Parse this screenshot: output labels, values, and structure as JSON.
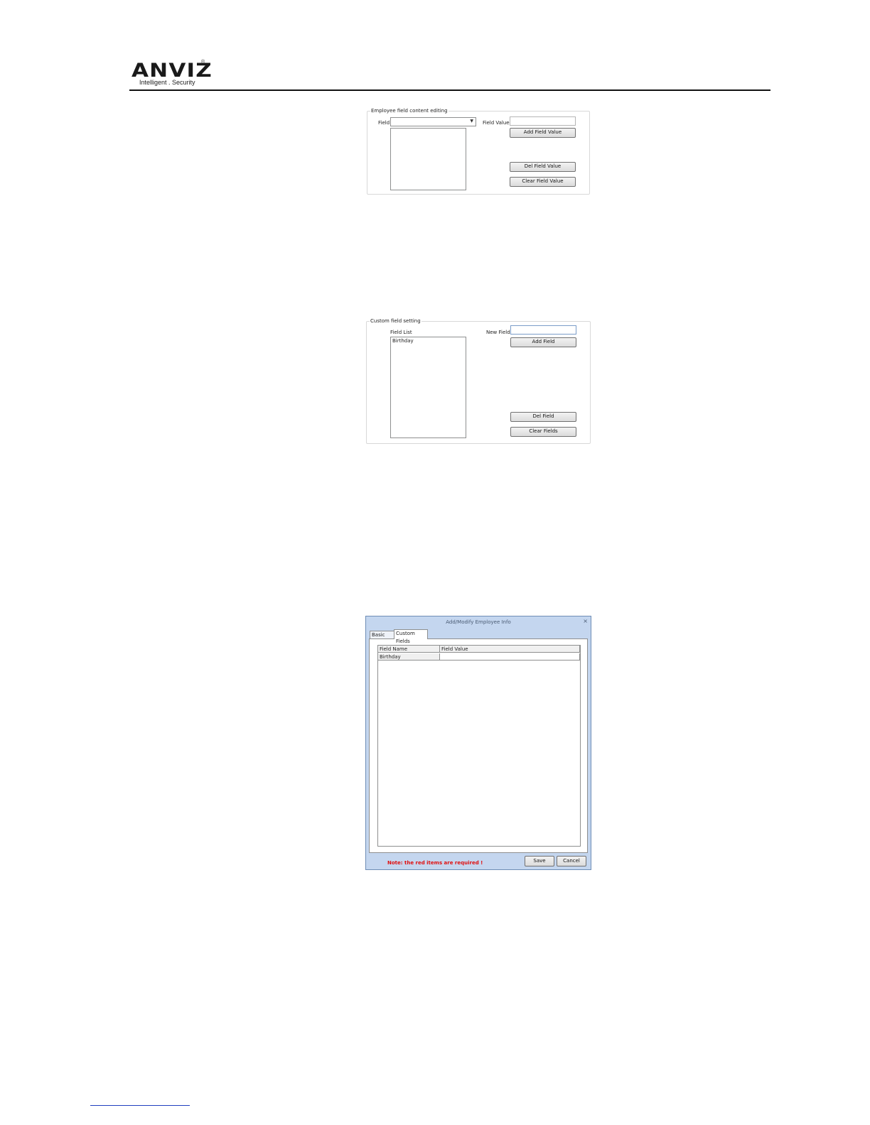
{
  "header": {
    "logo_text": "ANVIZ",
    "registered_mark": "®",
    "tagline": "Intelligent . Security"
  },
  "field_editing_panel": {
    "title": "Employee field content editing",
    "field_label": "Field",
    "field_selected": "",
    "field_value_label": "Field Value",
    "field_value_input": "",
    "values": [],
    "add_button": "Add Field Value",
    "del_button": "Del Field Value",
    "clear_button": "Clear Field Value"
  },
  "custom_field_panel": {
    "title": "Custom field setting",
    "field_list_label": "Field List",
    "new_field_label": "New Field",
    "new_field_input": "",
    "fields": [
      "Birthday"
    ],
    "add_button": "Add Field",
    "del_button": "Del Field",
    "clear_button": "Clear Fields"
  },
  "dialog": {
    "title": "Add/Modify Employee Info",
    "close_glyph": "×",
    "tabs": [
      {
        "label": "Basic Info",
        "active": false
      },
      {
        "label": "Custom Fields",
        "active": true
      }
    ],
    "grid": {
      "columns": [
        "Field Name",
        "Field Value"
      ],
      "rows": [
        {
          "name": "Birthday",
          "value": ""
        }
      ]
    },
    "note": "Note: the red items are required !",
    "save_button": "Save",
    "cancel_button": "Cancel"
  }
}
